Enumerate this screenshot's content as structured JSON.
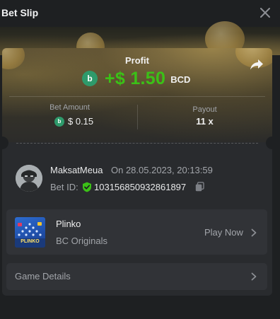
{
  "header": {
    "title": "Bet Slip",
    "close_icon": "close-icon"
  },
  "result": {
    "profit_label": "Profit",
    "profit_value": "+$ 1.50",
    "currency": "BCD",
    "coin_icon": "bc-coin-icon",
    "share_icon": "share-icon",
    "profit_color": "#3bc117"
  },
  "bet": {
    "amount_label": "Bet Amount",
    "amount_value": "$ 0.15",
    "payout_label": "Payout",
    "payout_value": "11 x"
  },
  "user": {
    "name": "MaksatMeua",
    "datetime": "On 28.05.2023, 20:13:59",
    "bet_id_label": "Bet ID:",
    "bet_id": "103156850932861897",
    "shield_icon": "verified-shield-icon",
    "copy_icon": "copy-icon"
  },
  "game": {
    "name": "Plinko",
    "provider": "BC Originals",
    "thumb_text": "PLINKO",
    "play_label": "Play Now",
    "chevron_icon": "chevron-right-icon"
  },
  "details": {
    "label": "Game Details"
  },
  "colors": {
    "background": "#1e2022",
    "card": "#292b2e",
    "row": "#313337",
    "accent_green": "#3bc117",
    "coin_green": "#2e9a6b"
  }
}
